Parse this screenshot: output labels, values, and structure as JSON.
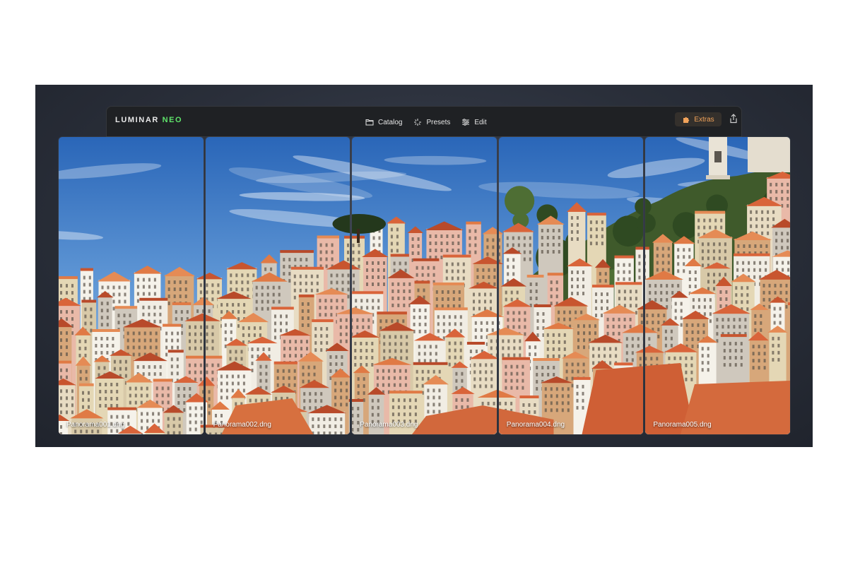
{
  "app": {
    "logo_main": "LUMINAR",
    "logo_accent": "NEO",
    "accent_color": "#5ee36a"
  },
  "nav": {
    "items": [
      {
        "label": "Catalog",
        "icon": "folder-icon"
      },
      {
        "label": "Presets",
        "icon": "sparkle-icon"
      },
      {
        "label": "Edit",
        "icon": "sliders-icon"
      }
    ]
  },
  "toolbar": {
    "extras_label": "Extras",
    "extras_icon": "puzzle-icon",
    "extras_color": "#f2a35a",
    "share_icon": "share-icon"
  },
  "images": [
    {
      "filename": "Panorama001.dng"
    },
    {
      "filename": "Panorama002.dng"
    },
    {
      "filename": "Panorama003.dng"
    },
    {
      "filename": "Panorama004.dng"
    },
    {
      "filename": "Panorama005.dng"
    }
  ]
}
